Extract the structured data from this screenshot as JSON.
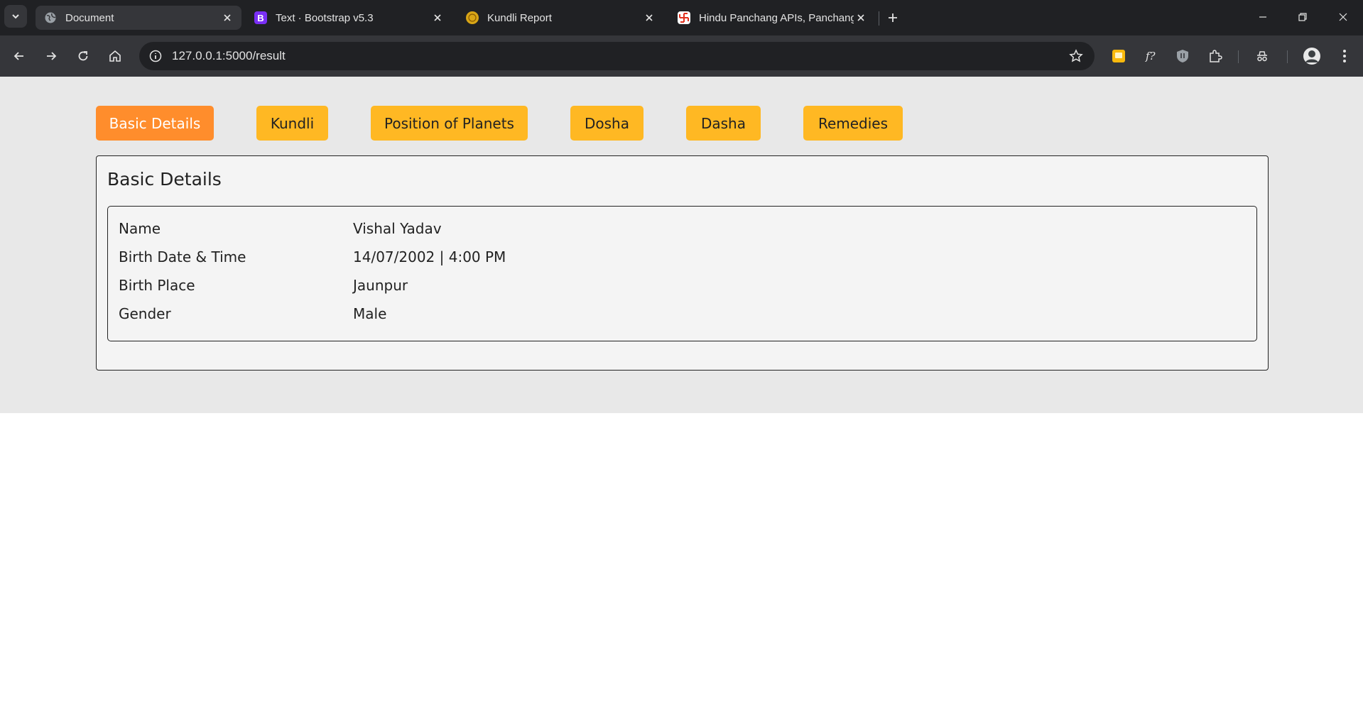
{
  "browser": {
    "tabs": [
      {
        "title": "Document",
        "favicon": "globe-icon",
        "active": true
      },
      {
        "title": "Text · Bootstrap v5.3",
        "favicon": "bootstrap-icon",
        "favicon_letter": "B",
        "active": false
      },
      {
        "title": "Kundli Report",
        "favicon": "kundli-logo-icon",
        "active": false
      },
      {
        "title": "Hindu Panchang APIs, Panchang",
        "favicon": "swastika-icon",
        "active": false
      }
    ],
    "url": "127.0.0.1:5000/result",
    "colors": {
      "tabstrip": "#202124",
      "toolbar": "#35363a",
      "bootstrap": "#7a2ff5",
      "kundli": "#d8a516"
    }
  },
  "nav": {
    "buttons": [
      {
        "label": "Basic Details",
        "active": true
      },
      {
        "label": "Kundli",
        "active": false
      },
      {
        "label": "Position of Planets",
        "active": false
      },
      {
        "label": "Dosha",
        "active": false
      },
      {
        "label": "Dasha",
        "active": false
      },
      {
        "label": "Remedies",
        "active": false
      }
    ],
    "colors": {
      "active": "#ff8d2c",
      "inactive": "#ffb823"
    }
  },
  "basic_details": {
    "title": "Basic Details",
    "rows": [
      {
        "label": "Name",
        "value": "Vishal Yadav"
      },
      {
        "label": "Birth Date & Time",
        "value": "14/07/2002 | 4:00 PM"
      },
      {
        "label": "Birth Place",
        "value": "Jaunpur"
      },
      {
        "label": "Gender",
        "value": "Male"
      }
    ]
  }
}
